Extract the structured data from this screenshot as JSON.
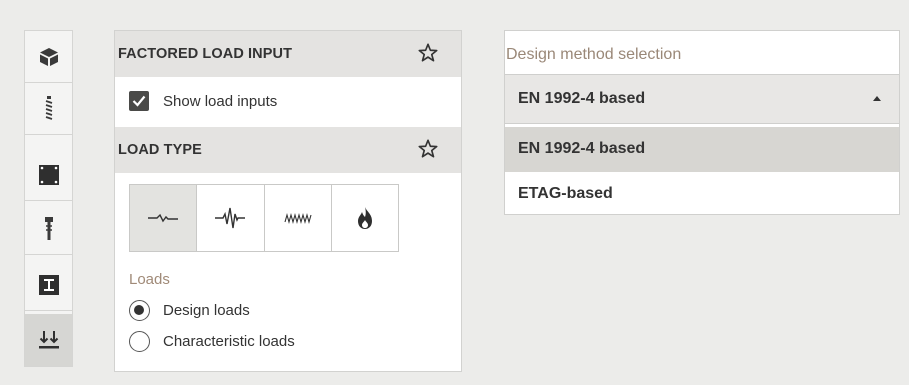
{
  "toolbar": {
    "items": [
      {
        "icon": "cube-icon",
        "active": false
      },
      {
        "icon": "anchor-rod-icon",
        "active": false
      },
      {
        "icon": "base-plate-icon",
        "active": false
      },
      {
        "icon": "anchor-bolt-icon",
        "active": false
      },
      {
        "icon": "profile-icon",
        "active": false
      },
      {
        "icon": "loads-icon",
        "active": true
      }
    ]
  },
  "factored_load": {
    "title": "FACTORED LOAD INPUT",
    "show_inputs_label": "Show load inputs",
    "show_inputs_checked": true
  },
  "load_type": {
    "title": "LOAD TYPE",
    "options": [
      {
        "icon": "static-load-icon",
        "selected": true
      },
      {
        "icon": "seismic-load-icon",
        "selected": false
      },
      {
        "icon": "fatigue-load-icon",
        "selected": false
      },
      {
        "icon": "fire-load-icon",
        "selected": false
      }
    ]
  },
  "loads": {
    "label": "Loads",
    "options": [
      {
        "label": "Design loads",
        "selected": true
      },
      {
        "label": "Characteristic loads",
        "selected": false
      }
    ]
  },
  "design_method": {
    "label": "Design method selection",
    "selected": "EN 1992-4 based",
    "options": [
      "EN 1992-4 based",
      "ETAG-based"
    ],
    "highlighted_index": 0
  },
  "colors": {
    "background": "#ececea",
    "header_gray": "#e4e3e1",
    "accent_label": "#a08a78",
    "checkbox": "#4a4a48"
  }
}
